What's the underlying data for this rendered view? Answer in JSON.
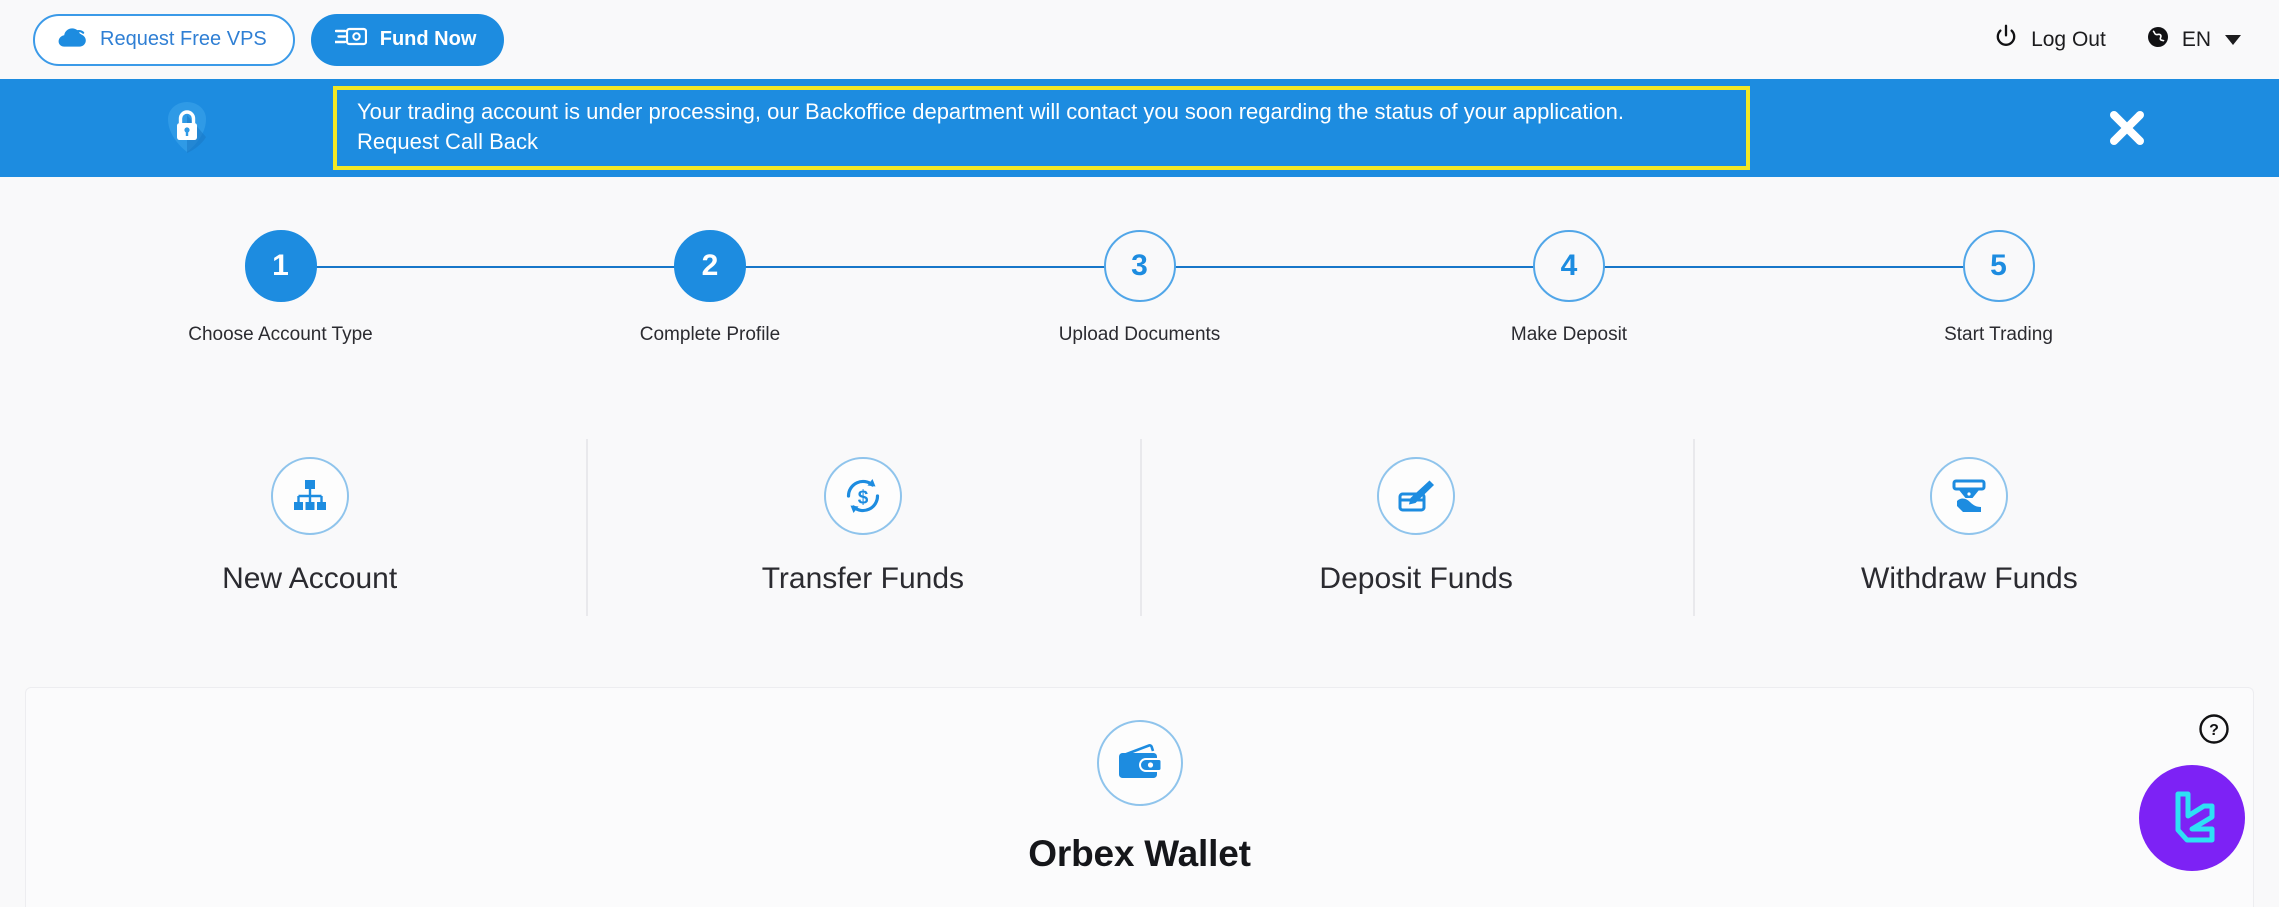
{
  "header": {
    "vps_button": "Request Free VPS",
    "fund_button": "Fund Now",
    "logout": "Log Out",
    "language": "EN"
  },
  "banner": {
    "message": "Your trading account is under processing, our Backoffice department will contact you soon regarding the status of your application.",
    "link": "Request Call Back",
    "highlight_color": "#f2e825",
    "background_color": "#1d8ce0"
  },
  "steps": [
    {
      "number": "1",
      "label": "Choose Account Type",
      "state": "done"
    },
    {
      "number": "2",
      "label": "Complete Profile",
      "state": "done"
    },
    {
      "number": "3",
      "label": "Upload Documents",
      "state": "todo"
    },
    {
      "number": "4",
      "label": "Make Deposit",
      "state": "todo"
    },
    {
      "number": "5",
      "label": "Start Trading",
      "state": "todo"
    }
  ],
  "actions": [
    {
      "label": "New Account",
      "icon": "org-chart-icon"
    },
    {
      "label": "Transfer Funds",
      "icon": "dollar-refresh-icon"
    },
    {
      "label": "Deposit Funds",
      "icon": "card-pen-icon"
    },
    {
      "label": "Withdraw Funds",
      "icon": "atm-cash-icon"
    }
  ],
  "wallet": {
    "title": "Orbex Wallet",
    "icon": "wallet-icon"
  },
  "widgets": {
    "help_icon": "question-circle-icon",
    "chat_icon": "livechat-logo-icon",
    "chat_color": "#7d22f5"
  },
  "theme": {
    "accent": "#1d8ce0",
    "page_background": "#f9f9fa"
  }
}
